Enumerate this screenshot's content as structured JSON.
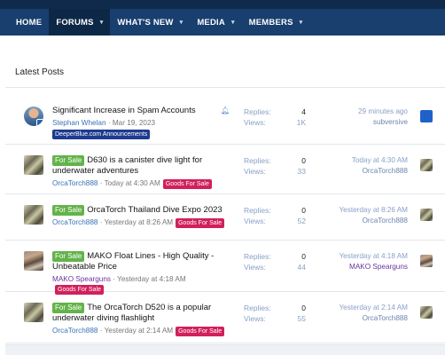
{
  "nav": {
    "items": [
      {
        "label": "HOME",
        "caret": false
      },
      {
        "label": "FORUMS",
        "caret": true
      },
      {
        "label": "WHAT'S NEW",
        "caret": true
      },
      {
        "label": "MEDIA",
        "caret": true
      },
      {
        "label": "MEMBERS",
        "caret": true
      }
    ],
    "active": "FORUMS"
  },
  "section_title": "Latest Posts",
  "posts": [
    {
      "title": "Significant Increase in Spam Accounts",
      "prefix": "",
      "author": "Stephan Whelan",
      "date": "Mar 19, 2023",
      "label": "DeeperBlue.com Announcements",
      "replies_label": "Replies:",
      "replies": "4",
      "views_label": "Views:",
      "views": "1K",
      "last_time": "29 minutes ago",
      "last_user": "subversive",
      "watched": true
    },
    {
      "title": "D630 is a canister dive light for underwater adventures",
      "prefix": "For Sale",
      "author": "OrcaTorch888",
      "date": "Today at 4:30 AM",
      "label": "Goods For Sale",
      "replies_label": "Replies:",
      "replies": "0",
      "views_label": "Views:",
      "views": "33",
      "last_time": "Today at 4:30 AM",
      "last_user": "OrcaTorch888"
    },
    {
      "title": "OrcaTorch Thailand Dive Expo 2023",
      "prefix": "For Sale",
      "author": "OrcaTorch888",
      "date": "Yesterday at 8:26 AM",
      "label": "Goods For Sale",
      "replies_label": "Replies:",
      "replies": "0",
      "views_label": "Views:",
      "views": "52",
      "last_time": "Yesterday at 8:26 AM",
      "last_user": "OrcaTorch888"
    },
    {
      "title": "MAKO Float Lines - High Quality - Unbeatable Price",
      "prefix": "For Sale",
      "author": "MAKO Spearguns",
      "date": "Yesterday at 4:18 AM",
      "label": "Goods For Sale",
      "replies_label": "Replies:",
      "replies": "0",
      "views_label": "Views:",
      "views": "44",
      "last_time": "Yesterday at 4:18 AM",
      "last_user": "MAKO Spearguns"
    },
    {
      "title": "The OrcaTorch D520 is a popular underwater diving flashlight",
      "prefix": "For Sale",
      "author": "OrcaTorch888",
      "date": "Yesterday at 2:14 AM",
      "label": "Goods For Sale",
      "replies_label": "Replies:",
      "replies": "0",
      "views_label": "Views:",
      "views": "55",
      "last_time": "Yesterday at 2:14 AM",
      "last_user": "OrcaTorch888"
    }
  ],
  "icons": {
    "caret": "chevron-down-icon",
    "watch": "bell-icon"
  },
  "colors": {
    "nav_bg": "#183f6e",
    "nav_active": "#0d2747",
    "prefix_green": "#63b34a",
    "label_red": "#d1205b",
    "label_navy": "#1d3b8f",
    "link_blue": "#3a71b5"
  }
}
